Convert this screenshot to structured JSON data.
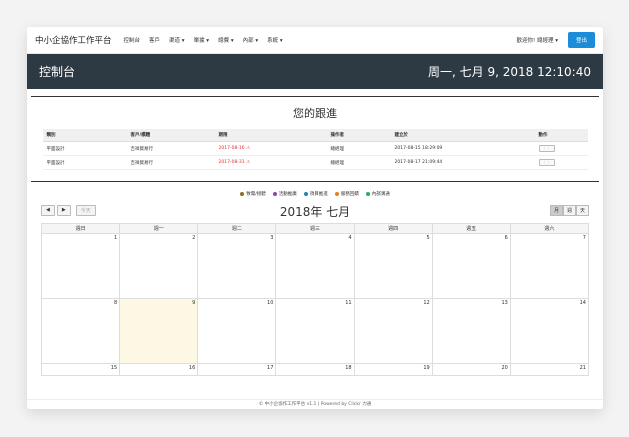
{
  "navbar": {
    "brand": "中小企協作工作平台",
    "items": [
      "控制台",
      "客戶",
      "渠道 ▾",
      "單據 ▾",
      "總費 ▾",
      "內部 ▾",
      "系統 ▾"
    ],
    "user": "歡迎你! 總經理 ▾",
    "logout": "登出"
  },
  "titlebar": {
    "title": "控制台",
    "clock": "周一, 七月 9, 2018 12:10:40"
  },
  "followup": {
    "title": "您的跟進",
    "headers": [
      "類別",
      "客戶/標題",
      "期限",
      "操作者",
      "建立於",
      "動作"
    ],
    "rows": [
      {
        "type": "平面設計",
        "client": "吉祥貿易行",
        "deadline": "2017-08-16 ⚠",
        "operator": "總經理",
        "created": "2017-08-15 18:29:09"
      },
      {
        "type": "平面設計",
        "client": "吉祥貿易行",
        "deadline": "2017-08-31 ⚠",
        "operator": "總經理",
        "created": "2017-08-17 21:09:44"
      }
    ]
  },
  "legend": [
    {
      "label": "致電/接聽",
      "color": "#8a6d1e"
    },
    {
      "label": "活動推廣",
      "color": "#8e44ad"
    },
    {
      "label": "項目推進",
      "color": "#2980b9"
    },
    {
      "label": "服務回饋",
      "color": "#e67e22"
    },
    {
      "label": "內部溝通",
      "color": "#27ae60"
    }
  ],
  "calendar": {
    "prev": "◀",
    "next": "▶",
    "today": "今天",
    "title": "2018年 七月",
    "views": [
      "月",
      "週",
      "天"
    ],
    "weekdays": [
      "週日",
      "週一",
      "週二",
      "週三",
      "週四",
      "週五",
      "週六"
    ],
    "weeks": [
      [
        "1",
        "2",
        "3",
        "4",
        "5",
        "6",
        "7"
      ],
      [
        "8",
        "9",
        "10",
        "11",
        "12",
        "13",
        "14"
      ],
      [
        "15",
        "16",
        "17",
        "18",
        "19",
        "20",
        "21"
      ]
    ]
  },
  "footer": "© 中小企協作工作平台 v1.1 | Powered by Clickr 力通"
}
